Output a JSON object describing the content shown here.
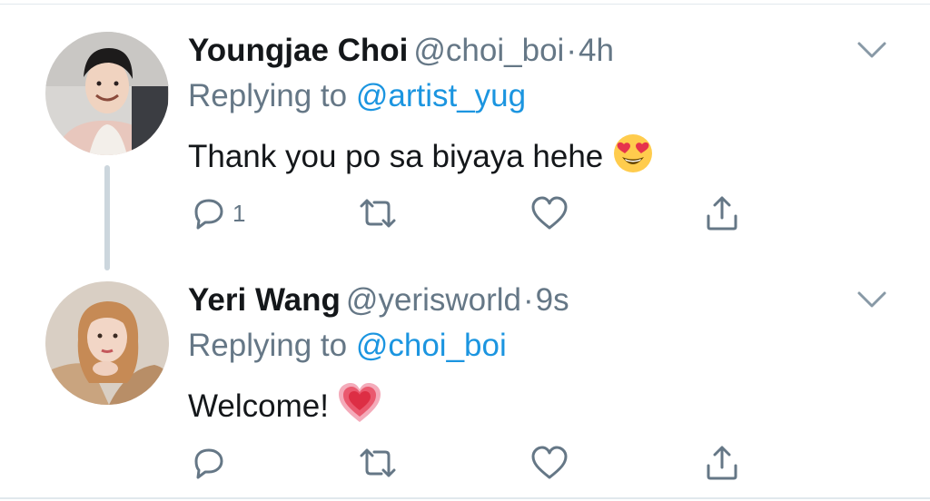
{
  "colors": {
    "name": "#14171a",
    "secondary": "#657786",
    "link": "#1b95e0",
    "divider": "#e1e8ed",
    "thread_line": "#ccd6dd"
  },
  "tweets": [
    {
      "display_name": "Youngjae Choi",
      "handle": "@choi_boi",
      "separator": "·",
      "time": "4h",
      "replying_label": "Replying to",
      "replying_to": "@artist_yug",
      "text": "Thank you po sa biyaya hehe",
      "emoji": "smiling-face-with-heart-eyes",
      "reply_count": "1",
      "icons": [
        "reply-icon",
        "retweet-icon",
        "like-icon",
        "share-icon",
        "chevron-down-icon"
      ]
    },
    {
      "display_name": "Yeri Wang",
      "handle": "@yerisworld",
      "separator": "·",
      "time": "9s",
      "replying_label": "Replying to",
      "replying_to": "@choi_boi",
      "text": "Welcome!",
      "emoji": "growing-heart",
      "reply_count": "",
      "icons": [
        "reply-icon",
        "retweet-icon",
        "like-icon",
        "share-icon",
        "chevron-down-icon"
      ]
    }
  ]
}
